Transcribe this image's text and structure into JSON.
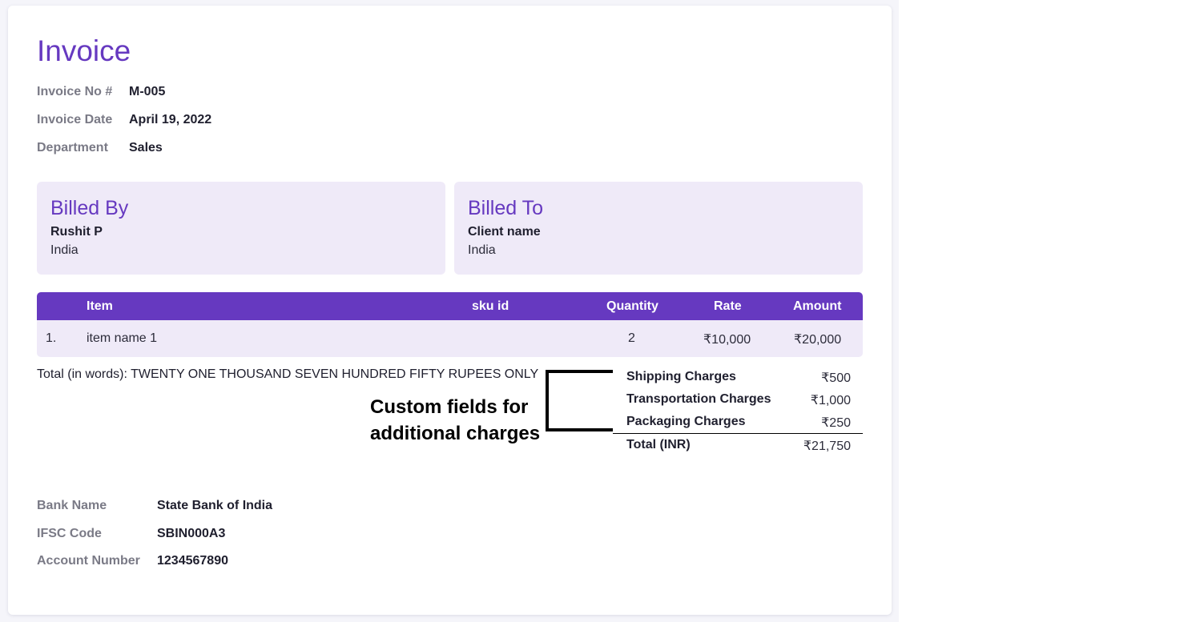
{
  "invoice": {
    "title": "Invoice",
    "meta": [
      {
        "label": "Invoice No #",
        "value": "M-005"
      },
      {
        "label": "Invoice Date",
        "value": "April 19, 2022"
      },
      {
        "label": "Department",
        "value": "Sales"
      }
    ],
    "billed_by": {
      "heading": "Billed By",
      "name": "Rushit P",
      "country": "India"
    },
    "billed_to": {
      "heading": "Billed To",
      "name": "Client name",
      "country": "India"
    },
    "table": {
      "headers": {
        "item": "Item",
        "sku": "sku id",
        "quantity": "Quantity",
        "rate": "Rate",
        "amount": "Amount"
      },
      "rows": [
        {
          "index": "1.",
          "item": "item name 1",
          "sku": "",
          "quantity": "2",
          "rate": "₹10,000",
          "amount": "₹20,000"
        }
      ]
    },
    "total_in_words": "Total (in words): TWENTY ONE THOUSAND SEVEN HUNDRED FIFTY RUPEES ONLY",
    "annotation": {
      "line1": "Custom fields for",
      "line2": "additional charges"
    },
    "charges": [
      {
        "label": "Shipping Charges",
        "value": "₹500"
      },
      {
        "label": "Transportation Charges",
        "value": "₹1,000"
      },
      {
        "label": "Packaging Charges",
        "value": "₹250"
      }
    ],
    "total": {
      "label": "Total (INR)",
      "value": "₹21,750"
    },
    "bank": [
      {
        "label": "Bank Name",
        "value": "State Bank of India"
      },
      {
        "label": "IFSC Code",
        "value": "SBIN000A3"
      },
      {
        "label": "Account Number",
        "value": "1234567890"
      }
    ]
  },
  "colors": {
    "accent": "#6639c0",
    "panel": "#efeaf8",
    "muted": "#7a7a86"
  }
}
